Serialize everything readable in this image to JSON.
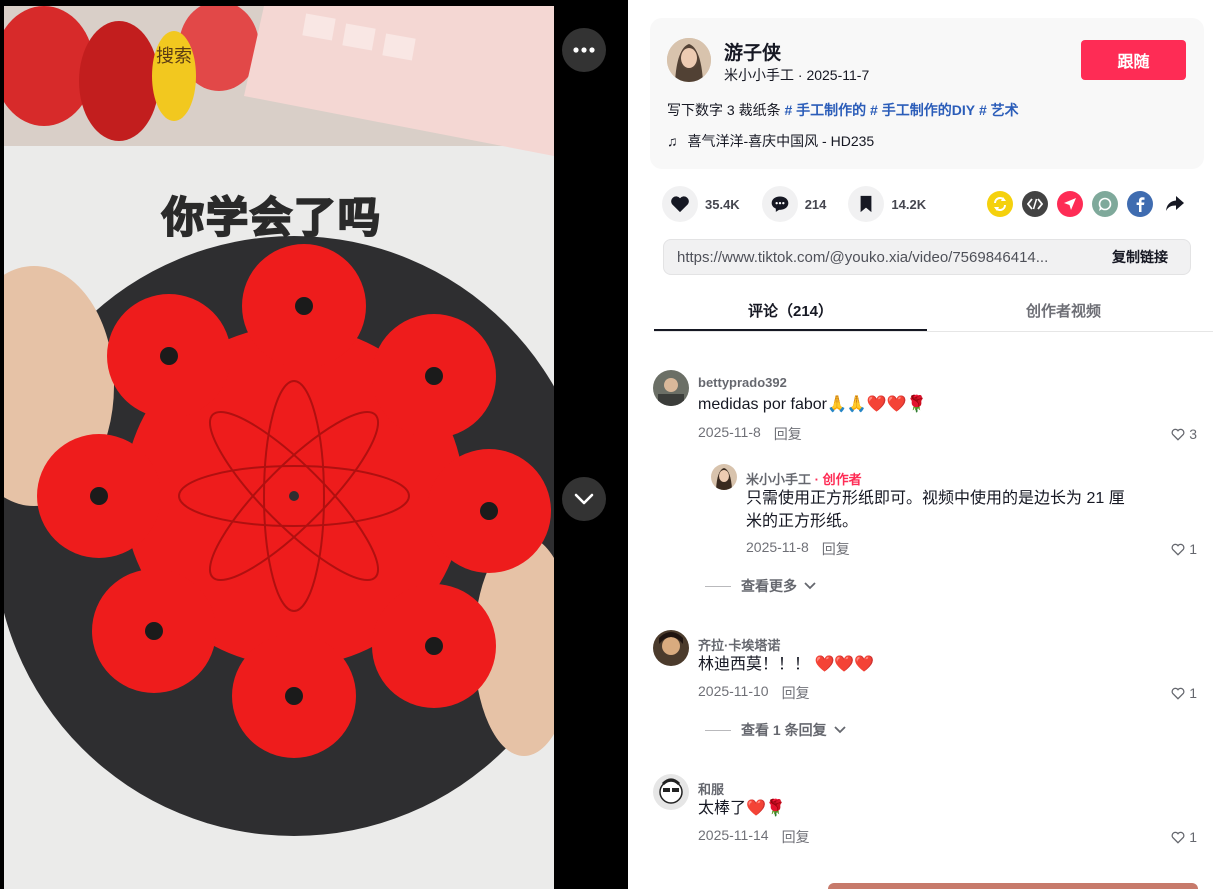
{
  "video": {
    "search_hint": "搜索",
    "caption": "你学会了吗",
    "keyboard_brand": "米小小手工"
  },
  "author": {
    "name": "游子侠",
    "subtitle": "米小小手工 · 2025-11-7",
    "follow_label": "跟随",
    "desc_text": "写下数字 3 裁纸条",
    "tags": [
      "# 手工制作的",
      " # 手工制作的DIY",
      "# 艺术"
    ],
    "music": "喜气洋洋-喜庆中国风 - HD235"
  },
  "stats": {
    "likes": "35.4K",
    "comments": "214",
    "saves": "14.2K"
  },
  "share": {
    "url": "https://www.tiktok.com/@youko.xia/video/7569846414...",
    "copy_label": "复制链接"
  },
  "tabs": [
    "评论（214）",
    "创作者视频"
  ],
  "comments": [
    {
      "user": "bettyprado392",
      "text": "medidas por fabor🙏🙏❤️❤️🌹",
      "date": "2025-11-8",
      "reply_label": "回复",
      "likes": "3",
      "reply": {
        "user": "米小小手工",
        "creator_label": " · 创作者",
        "text_line1": "只需使用正方形纸即可。视频中使用的是边长为 21 厘",
        "text_line2": "米的正方形纸。",
        "date": "2025-11-8",
        "reply_label": "回复",
        "likes": "1"
      },
      "view_more": "查看更多"
    },
    {
      "user": "齐拉·卡埃塔诺",
      "text": "林迪西莫！！！ ❤️❤️❤️",
      "date": "2025-11-10",
      "reply_label": "回复",
      "likes": "1",
      "view_more": "查看 1 条回复"
    },
    {
      "user": "和服",
      "text": "太棒了❤️🌹",
      "date": "2025-11-14",
      "reply_label": "回复",
      "likes": "1"
    }
  ],
  "colors": {
    "accent": "#fe2c55",
    "tag": "#2b5db9"
  }
}
